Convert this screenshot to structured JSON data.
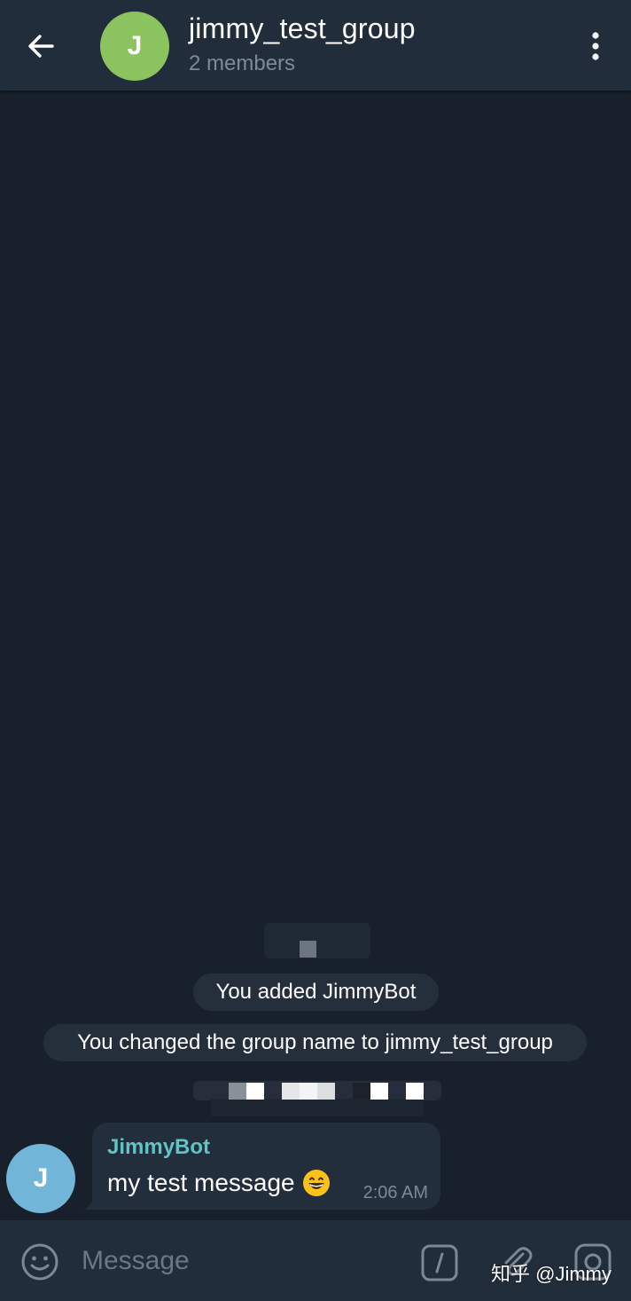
{
  "header": {
    "avatar_letter": "J",
    "title": "jimmy_test_group",
    "subtitle": "2 members",
    "avatar_color": "#8bc35e"
  },
  "messages": {
    "service_1": "You added JimmyBot",
    "service_2": "You changed the group name to jimmy_test_group",
    "message": {
      "avatar_letter": "J",
      "avatar_color": "#71b5d8",
      "sender": "JimmyBot",
      "text": "my test message",
      "emoji": "grinning-face-emoji",
      "time": "2:06 AM"
    }
  },
  "input": {
    "placeholder": "Message"
  },
  "watermark": "知乎 @Jimmy",
  "colors": {
    "background": "#18202b",
    "header": "#212d3b",
    "bubble": "#222e3b",
    "sender": "#62c3c4"
  },
  "icons": [
    "back-arrow-icon",
    "more-vertical-icon",
    "smile-icon",
    "slash-command-icon",
    "paperclip-icon",
    "camera-icon"
  ]
}
